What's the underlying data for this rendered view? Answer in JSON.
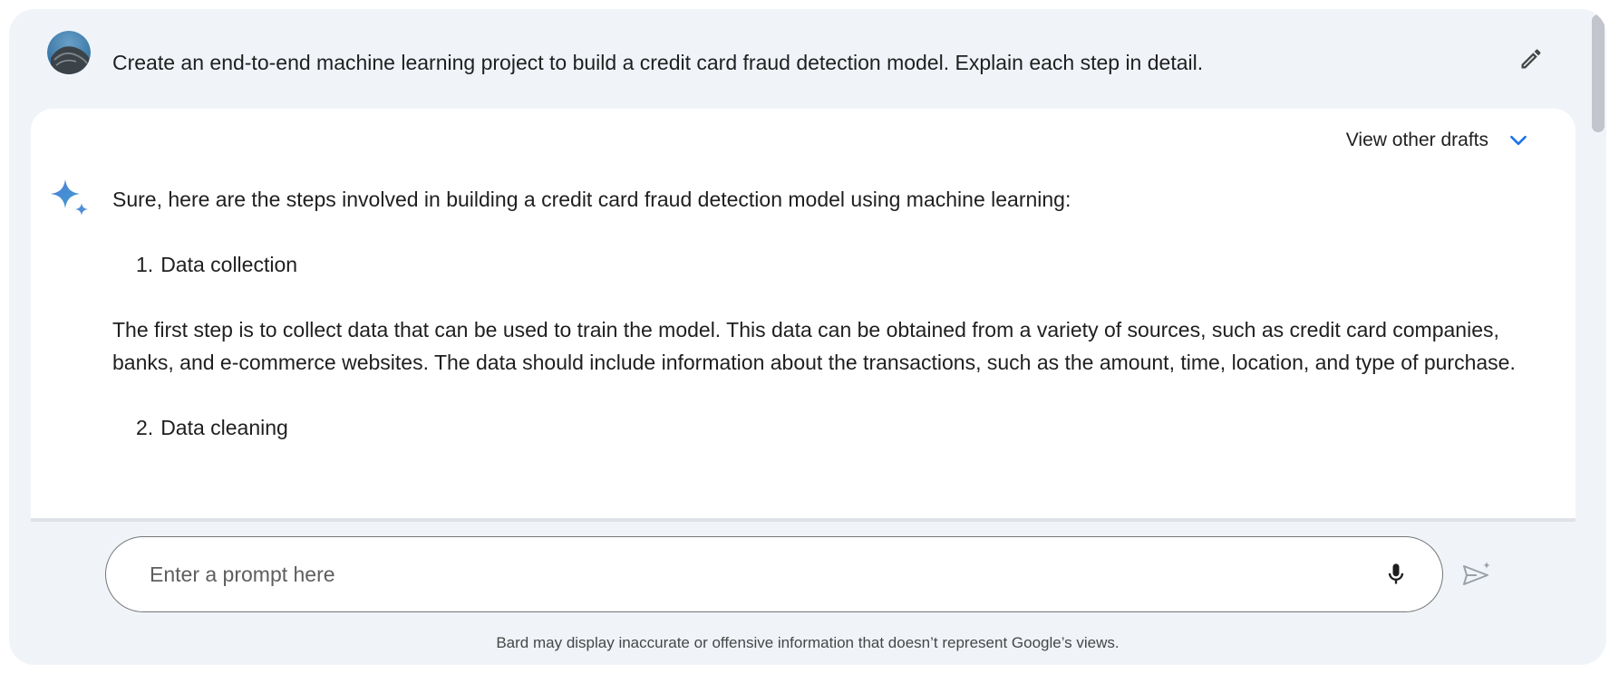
{
  "query": {
    "text": "Create an end-to-end machine learning project to build a credit card fraud detection model. Explain each step in detail.",
    "avatar_icon": "user-avatar",
    "edit_icon": "pencil-icon"
  },
  "response": {
    "drafts_label": "View other drafts",
    "intro": "Sure, here are the steps involved in building a credit card fraud detection model using machine learning:",
    "steps": [
      {
        "num": "1.",
        "title": "Data collection",
        "body": "The first step is to collect data that can be used to train the model. This data can be obtained from a variety of sources, such as credit card companies, banks, and e-commerce websites. The data should include information about the transactions, such as the amount, time, location, and type of purchase."
      },
      {
        "num": "2.",
        "title": "Data cleaning"
      }
    ]
  },
  "input": {
    "placeholder": "Enter a prompt here",
    "value": ""
  },
  "footer": {
    "disclaimer": "Bard may display inaccurate or offensive information that doesn’t represent Google’s views."
  },
  "colors": {
    "frame_bg": "#f0f4f9",
    "card_bg": "#ffffff",
    "accent": "#1a73e8"
  }
}
